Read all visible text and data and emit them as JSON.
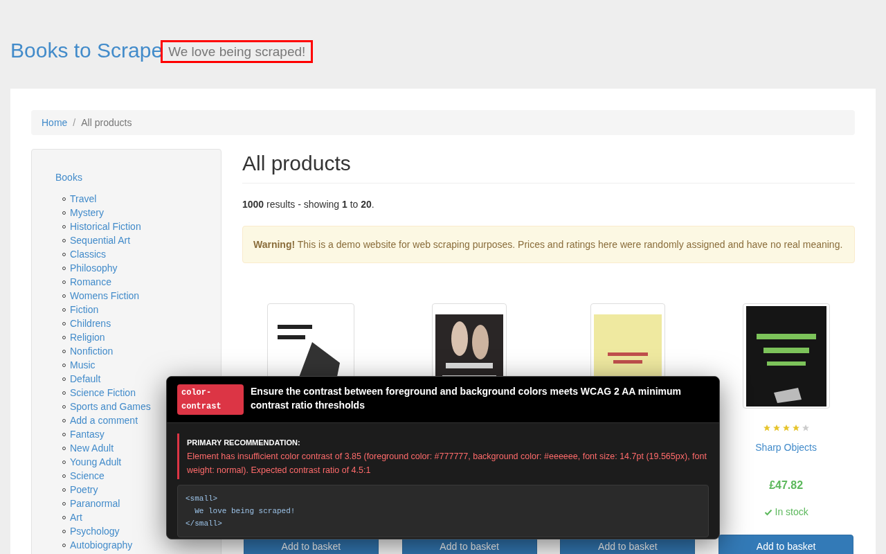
{
  "header": {
    "brand": "Books to Scrape",
    "tagline": "We love being scraped!",
    "tagline_highlighted": true
  },
  "breadcrumb": [
    {
      "label": "Home",
      "link": true
    },
    {
      "separator": "/",
      "label": "All products",
      "link": false
    }
  ],
  "sidebar": {
    "title": "Books",
    "items": [
      "Travel",
      "Mystery",
      "Historical Fiction",
      "Sequential Art",
      "Classics",
      "Philosophy",
      "Romance",
      "Womens Fiction",
      "Fiction",
      "Childrens",
      "Religion",
      "Nonfiction",
      "Music",
      "Default",
      "Science Fiction",
      "Sports and Games",
      "Add a comment",
      "Fantasy",
      "New Adult",
      "Young Adult",
      "Science",
      "Poetry",
      "Paranormal",
      "Art",
      "Psychology",
      "Autobiography"
    ]
  },
  "main": {
    "heading": "All products",
    "results": "**1000** results - showing **1** to **20**.",
    "warning": "**Warning!** This is a demo website for web scraping purposes. Prices and ratings here were randomly assigned and have no real meaning."
  },
  "products": [
    {
      "button": "Add to basket"
    },
    {
      "button": "Add to basket"
    },
    {
      "button": "Add to basket"
    },
    {
      "stars": 4,
      "title": "Sharp Objects",
      "price": "£47.82",
      "availability": "In stock",
      "button": "Add to basket"
    }
  ],
  "popup": {
    "rule": "color-contrast",
    "title": "Ensure the contrast between foreground and background colors meets WCAG 2 AA minimum contrast ratio thresholds",
    "recommendation_label": "PRIMARY RECOMMENDATION:",
    "recommendation": "Element has insufficient color contrast of 3.85 (foreground color: #777777, background color: #eeeeee, font size: 14.7pt (19.565px), font weight: normal). Expected contrast ratio of 4.5:1",
    "code": [
      "<small>",
      "  We love being scraped!",
      "</small>"
    ]
  }
}
